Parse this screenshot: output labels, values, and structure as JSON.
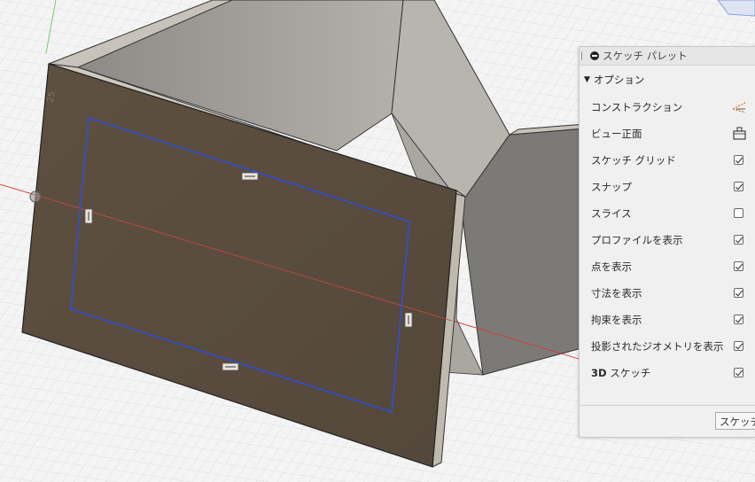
{
  "viewport": {
    "axis_label_top": "50",
    "axis_label_left": "25"
  },
  "palette": {
    "title": "スケッチ パレット",
    "section_label": "オプション",
    "options": [
      {
        "label": "コンストラクション",
        "control": "icon",
        "icon": "construction-line-icon"
      },
      {
        "label": "ビュー正面",
        "control": "icon",
        "icon": "look-at-view-icon"
      },
      {
        "label": "スケッチ グリッド",
        "control": "checkbox",
        "checked": true
      },
      {
        "label": "スナップ",
        "control": "checkbox",
        "checked": true
      },
      {
        "label": "スライス",
        "control": "checkbox",
        "checked": false
      },
      {
        "label": "プロファイルを表示",
        "control": "checkbox",
        "checked": true
      },
      {
        "label": "点を表示",
        "control": "checkbox",
        "checked": true
      },
      {
        "label": "寸法を表示",
        "control": "checkbox",
        "checked": true
      },
      {
        "label": "拘束を表示",
        "control": "checkbox",
        "checked": true
      },
      {
        "label": "投影されたジオメトリを表示",
        "control": "checkbox",
        "checked": true
      },
      {
        "label": "スケッチ",
        "label_prefix": "3D",
        "control": "checkbox",
        "checked": true
      }
    ],
    "finish_button": "スケッチを停止"
  },
  "colors": {
    "panel_face": "#5a4c3e",
    "sketch_line": "#2f4fd0",
    "x_axis": "#d23a3a",
    "y_axis": "#6fcf6f",
    "wall_light": "#a7a39d",
    "wall_dark": "#7a7874"
  }
}
